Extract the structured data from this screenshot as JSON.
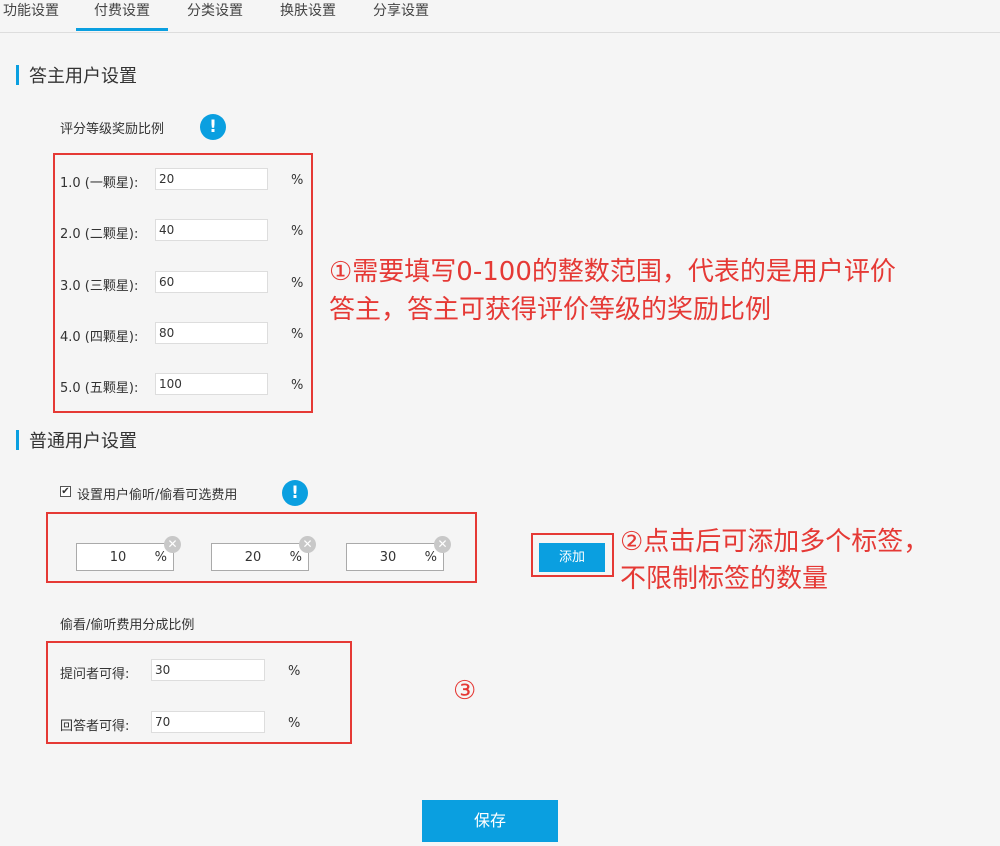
{
  "tabs": [
    "功能设置",
    "付费设置",
    "分类设置",
    "换肤设置",
    "分享设置"
  ],
  "answerer": {
    "title": "答主用户设置",
    "subtitle": "评分等级奖励比例",
    "info_glyph": "!",
    "rows": [
      {
        "label": "1.0 (一颗星):",
        "value": "20",
        "unit": "%"
      },
      {
        "label": "2.0 (二颗星):",
        "value": "40",
        "unit": "%"
      },
      {
        "label": "3.0 (三颗星):",
        "value": "60",
        "unit": "%"
      },
      {
        "label": "4.0 (四颗星):",
        "value": "80",
        "unit": "%"
      },
      {
        "label": "5.0 (五颗星):",
        "value": "100",
        "unit": "%"
      }
    ]
  },
  "annotations": {
    "note1_line1": "①需要填写0-100的整数范围，代表的是用户评价",
    "note1_line2": "答主，答主可获得评价等级的奖励比例",
    "note2_line1": "②点击后可添加多个标签，",
    "note2_line2": "不限制标签的数量",
    "note3": "③"
  },
  "normal": {
    "title": "普通用户设置",
    "checkbox_label": "设置用户偷听/偷看可选费用",
    "checkbox_checked": true,
    "info_glyph": "!",
    "tags": [
      {
        "value": "10",
        "unit": "%"
      },
      {
        "value": "20",
        "unit": "%"
      },
      {
        "value": "30",
        "unit": "%"
      }
    ],
    "add_label": "添加",
    "split_title": "偷看/偷听费用分成比例",
    "split_rows": [
      {
        "label": "提问者可得:",
        "value": "30",
        "unit": "%"
      },
      {
        "label": "回答者可得:",
        "value": "70",
        "unit": "%"
      }
    ]
  },
  "save_label": "保存",
  "colors": {
    "accent": "#0a9fe0",
    "annotation": "#e53935"
  }
}
